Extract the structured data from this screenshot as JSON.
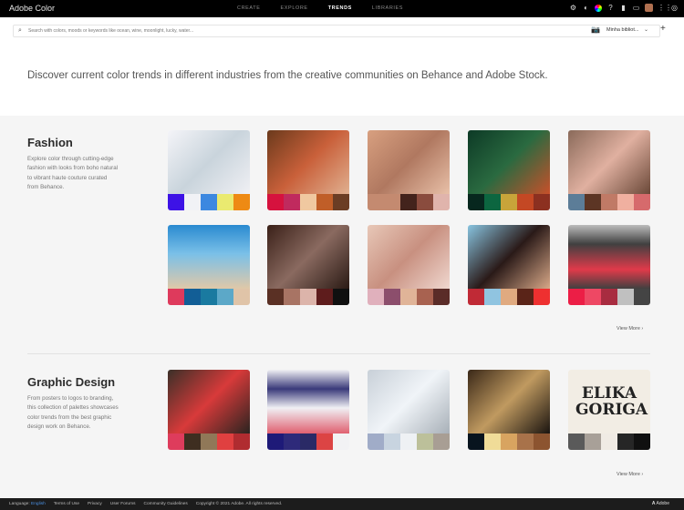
{
  "app": {
    "title": "Adobe Color"
  },
  "nav": [
    {
      "label": "CREATE",
      "active": false
    },
    {
      "label": "EXPLORE",
      "active": false
    },
    {
      "label": "TRENDS",
      "active": true
    },
    {
      "label": "LIBRARIES",
      "active": false
    }
  ],
  "search": {
    "placeholder": "Search with colors, moods or keywords like ocean, wine, moonlight, lucky, water...",
    "library": "Minha bibliot...",
    "chevron": "⌄",
    "plus": "+"
  },
  "hero": "Discover current color trends in different industries from the creative communities on Behance and Adobe Stock.",
  "sections": [
    {
      "title": "Fashion",
      "description": "Explore color through cutting-edge fashion with looks from boho natural to vibrant haute couture curated from Behance.",
      "view_more": "View More ›",
      "cards": [
        {
          "image": "linear-gradient(135deg,#f4f4f8,#c9d4dc 50%,#f0f0f4)",
          "palette": [
            "#3d12e6",
            "#f1f2f6",
            "#3c88e0",
            "#eaea70",
            "#ee8a14"
          ]
        },
        {
          "image": "linear-gradient(135deg,#6b3a1c,#c9603a 50%,#e0b090)",
          "palette": [
            "#d6123e",
            "#c02a5e",
            "#f0c8a0",
            "#c05e28",
            "#6b3d24"
          ]
        },
        {
          "image": "linear-gradient(135deg,#d8a080,#b07860 50%,#e8c0a8)",
          "palette": [
            "#c48a70",
            "#c48a70",
            "#43231c",
            "#8a4c3e",
            "#e0b4ac"
          ]
        },
        {
          "image": "linear-gradient(135deg,#0d3a26,#2a6a40 50%,#c8502a)",
          "palette": [
            "#07271e",
            "#0c6640",
            "#c8a43a",
            "#c44824",
            "#8c3020"
          ]
        },
        {
          "image": "linear-gradient(135deg,#8a6a5a,#e0b0a0 50%,#6a4838)",
          "palette": [
            "#5c7d98",
            "#5c3524",
            "#c07a66",
            "#f0b0a0",
            "#d66a6c"
          ]
        },
        {
          "image": "linear-gradient(180deg,#2a8ad0,#7ac0e8 45%,#e0c8a8)",
          "palette": [
            "#de3a5c",
            "#125e96",
            "#1a7aa0",
            "#5ca8c8",
            "#e0c4a8"
          ]
        },
        {
          "image": "linear-gradient(135deg,#3a2018,#8a6a60 50%,#2a1a14)",
          "palette": [
            "#5a3024",
            "#a87464",
            "#dcb4aa",
            "#5e1c1c",
            "#101010"
          ]
        },
        {
          "image": "linear-gradient(135deg,#e8c8b8,#c89080 50%,#f0d8d0)",
          "palette": [
            "#e0b0bc",
            "#8c4e6c",
            "#e0b498",
            "#a86250",
            "#5a2c28"
          ]
        },
        {
          "image": "linear-gradient(135deg,#88c4e0,#2a1a18 50%,#d8a888)",
          "palette": [
            "#c02a36",
            "#90c4e0",
            "#e0aa80",
            "#5a2418",
            "#ee3030"
          ]
        },
        {
          "image": "linear-gradient(180deg,#bcbcbc,#404040 30%,#e03a4a 70%,#404040)",
          "palette": [
            "#ec1e46",
            "#ee4864",
            "#a82c40",
            "#c0c0c0",
            "#444444"
          ]
        }
      ]
    },
    {
      "title": "Graphic Design",
      "description": "From posters to logos to branding, this collection of palettes showcases color trends from the best graphic design work on Behance.",
      "view_more": "View More ›",
      "cards": [
        {
          "image": "linear-gradient(135deg,#3a3028,#d83a3a 50%,#2a2420)",
          "palette": [
            "#de3c5c",
            "#3e2e20",
            "#907858",
            "#e04040",
            "#b02c30"
          ]
        },
        {
          "image": "linear-gradient(180deg,#f0f0f4,#3a3a7a 30%,#f0f0f4 60%,#e06070)",
          "palette": [
            "#1e1a78",
            "#2e2a7a",
            "#2a2a66",
            "#dc4444",
            "#f2f2f4"
          ]
        },
        {
          "image": "linear-gradient(135deg,#c8d0d8,#f0f4f8 50%,#a8b0b8)",
          "palette": [
            "#a0acc8",
            "#c8d4e0",
            "#eef1f4",
            "#bcc09a",
            "#a89e94"
          ]
        },
        {
          "image": "linear-gradient(135deg,#3a2818,#c09a60 50%,#1a1410)",
          "palette": [
            "#08141e",
            "#f0dc98",
            "#d8a460",
            "#a8724a",
            "#8c5430"
          ]
        },
        {
          "image": "linear-gradient(180deg,#f2ede4,#f2ede4)",
          "palette": [
            "#5a5a5a",
            "#a8a098",
            "#f0ebe4",
            "#262626",
            "#101010"
          ],
          "logo_text": "ELIKA GORIGA"
        }
      ]
    }
  ],
  "footer": {
    "language_label": "Language:",
    "language": "English",
    "links": [
      "Terms of Use",
      "Privacy",
      "User Forums",
      "Community Guidelines"
    ],
    "copyright": "Copyright © 2021 Adobe. All rights reserved.",
    "brand": "Adobe"
  }
}
